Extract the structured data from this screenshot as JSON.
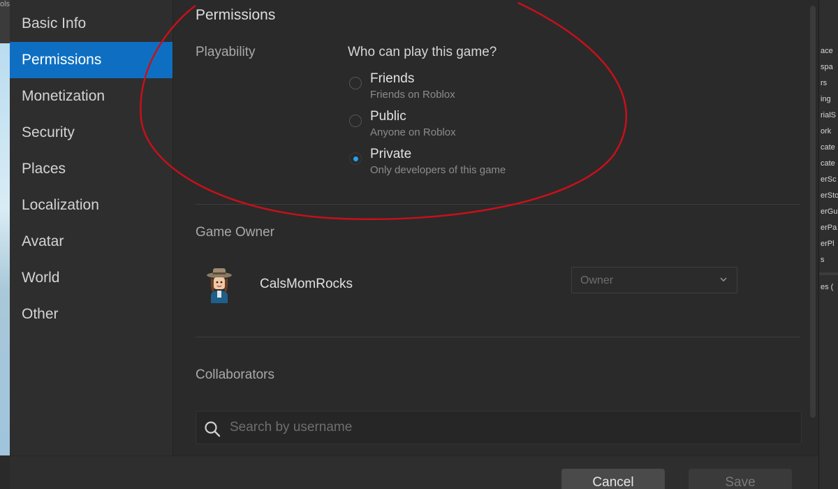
{
  "colors": {
    "accent": "#0e6fc2",
    "radio_selected": "#22a1f2",
    "annotation": "#c8101a"
  },
  "sidebar": {
    "items": [
      {
        "label": "Basic Info",
        "active": false
      },
      {
        "label": "Permissions",
        "active": true
      },
      {
        "label": "Monetization",
        "active": false
      },
      {
        "label": "Security",
        "active": false
      },
      {
        "label": "Places",
        "active": false
      },
      {
        "label": "Localization",
        "active": false
      },
      {
        "label": "Avatar",
        "active": false
      },
      {
        "label": "World",
        "active": false
      },
      {
        "label": "Other",
        "active": false
      }
    ]
  },
  "main": {
    "title": "Permissions",
    "playability": {
      "label": "Playability",
      "question": "Who can play this game?",
      "options": [
        {
          "title": "Friends",
          "subtitle": "Friends on Roblox",
          "selected": false
        },
        {
          "title": "Public",
          "subtitle": "Anyone on Roblox",
          "selected": false
        },
        {
          "title": "Private",
          "subtitle": "Only developers of this game",
          "selected": true
        }
      ]
    },
    "game_owner": {
      "label": "Game Owner",
      "name": "CalsMomRocks",
      "role_value": "Owner",
      "avatar_icon": "avatar-cowboy-hat"
    },
    "collaborators": {
      "label": "Collaborators",
      "search_placeholder": "Search by username",
      "search_icon": "search-icon"
    }
  },
  "footer": {
    "cancel_label": "Cancel",
    "save_label": "Save"
  },
  "background": {
    "left_peek": "ols",
    "explorer_rows": [
      "ace",
      "spa",
      "rs",
      "ing",
      "rialS",
      "ork",
      "cate",
      "cate",
      "erSc",
      "erSto",
      "erGu",
      "erPa",
      "erPl",
      "s",
      "es ("
    ]
  }
}
